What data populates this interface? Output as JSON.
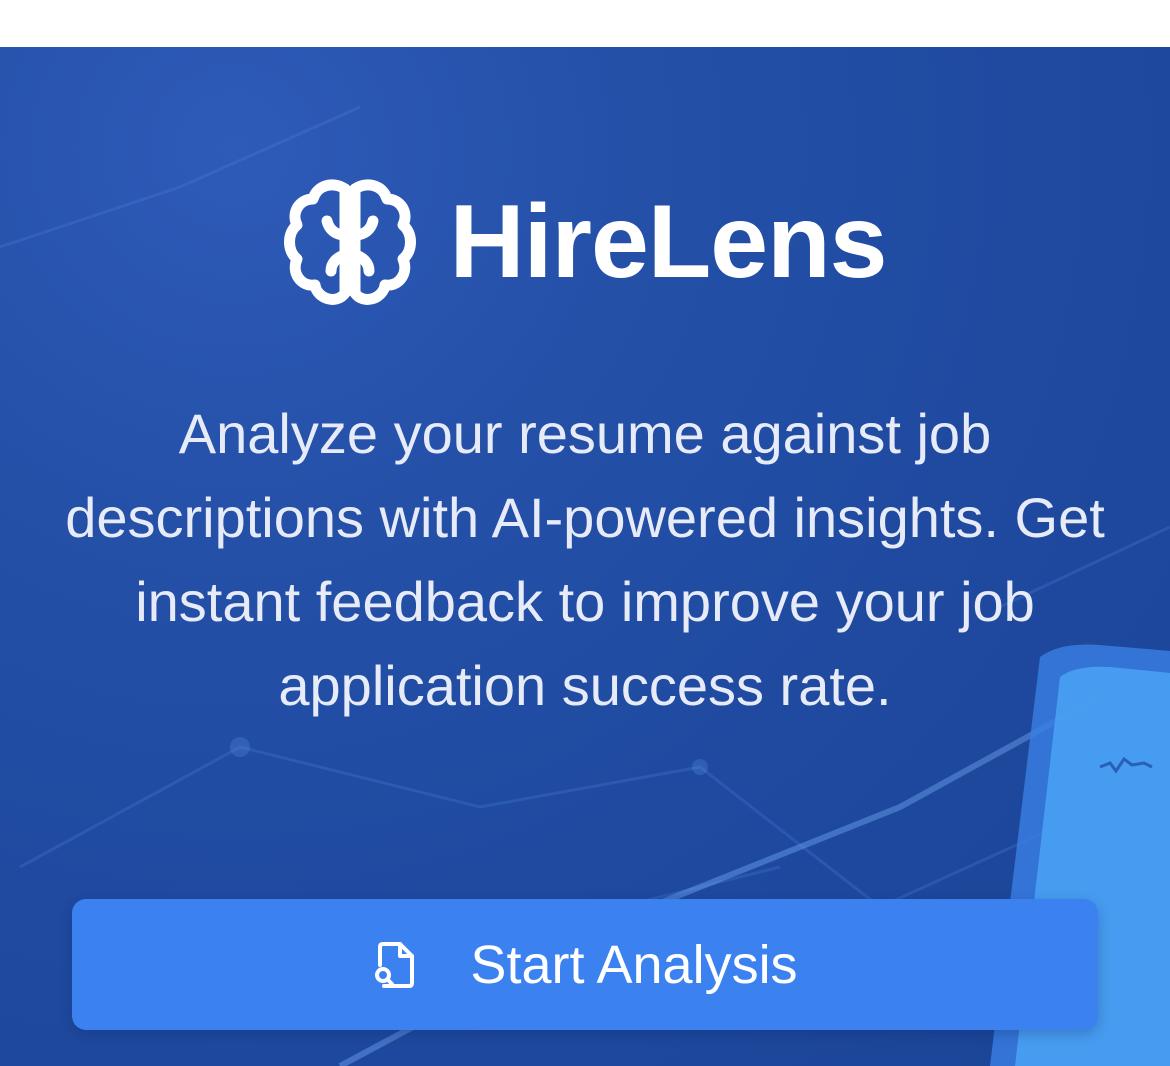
{
  "app": {
    "brand_name": "HireLens",
    "logo_icon": "brain-icon"
  },
  "hero": {
    "tagline": "Analyze your resume against job descriptions with AI-powered insights. Get instant feedback to improve your job application success rate.",
    "background_color": "#1f4aa0"
  },
  "cta": {
    "label": "Start Analysis",
    "icon": "file-search-icon",
    "color": "#3b82f0"
  }
}
